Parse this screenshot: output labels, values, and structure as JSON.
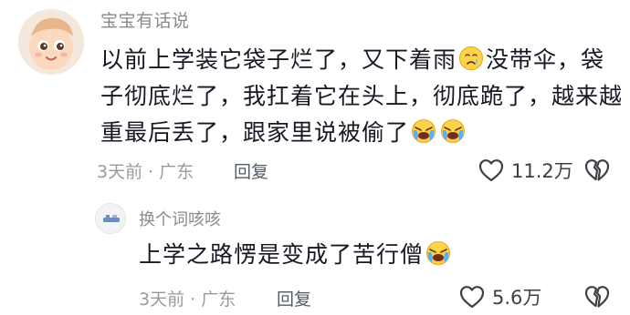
{
  "comment": {
    "username": "宝宝有话说",
    "text_lines": [
      [
        "以前上学装它袋子烂了，又下着雨",
        "没带伞，袋"
      ],
      [
        "子彻底烂了，我扛着它在头上，彻底跪了，越来越"
      ],
      [
        "重最后丢了，跟家里说被偷了"
      ]
    ],
    "emojis": [
      "sad-face-icon",
      "crying-face-icon"
    ],
    "time": "3天前",
    "separator": "·",
    "location": "广东",
    "reply_label": "回复",
    "like_count": "11.2万"
  },
  "reply": {
    "username": "换个词咳咳",
    "text": "上学之路愣是变成了苦行僧",
    "time": "3天前",
    "separator": "·",
    "location": "广东",
    "reply_label": "回复",
    "like_count": "5.6万"
  }
}
